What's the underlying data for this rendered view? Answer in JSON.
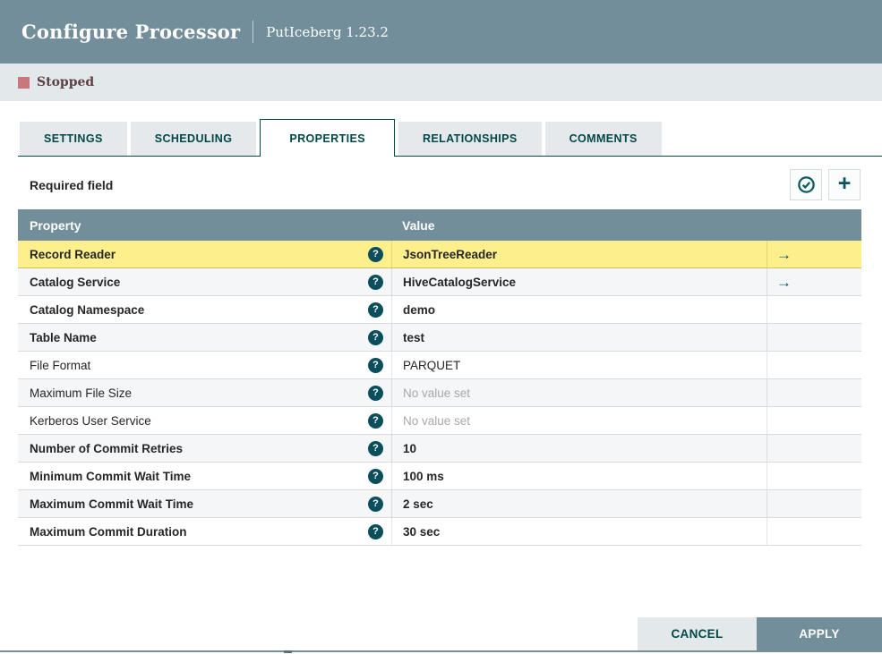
{
  "dialog": {
    "title": "Configure Processor",
    "subtitle": "PutIceberg 1.23.2"
  },
  "status": {
    "label": "Stopped"
  },
  "tabs": [
    {
      "label": "SETTINGS",
      "active": false
    },
    {
      "label": "SCHEDULING",
      "active": false
    },
    {
      "label": "PROPERTIES",
      "active": true
    },
    {
      "label": "RELATIONSHIPS",
      "active": false
    },
    {
      "label": "COMMENTS",
      "active": false
    }
  ],
  "toolbar": {
    "required_label": "Required field",
    "verify_icon": "check-circle-icon",
    "add_icon": "plus-icon"
  },
  "table": {
    "columns": [
      "Property",
      "Value"
    ],
    "rows": [
      {
        "property": "Record Reader",
        "value": "JsonTreeReader",
        "bold": true,
        "selected": true,
        "has_link": true,
        "empty": false
      },
      {
        "property": "Catalog Service",
        "value": "HiveCatalogService",
        "bold": true,
        "selected": false,
        "has_link": true,
        "empty": false
      },
      {
        "property": "Catalog Namespace",
        "value": "demo",
        "bold": true,
        "selected": false,
        "has_link": false,
        "empty": false
      },
      {
        "property": "Table Name",
        "value": "test",
        "bold": true,
        "selected": false,
        "has_link": false,
        "empty": false
      },
      {
        "property": "File Format",
        "value": "PARQUET",
        "bold": false,
        "selected": false,
        "has_link": false,
        "empty": false
      },
      {
        "property": "Maximum File Size",
        "value": "No value set",
        "bold": false,
        "selected": false,
        "has_link": false,
        "empty": true
      },
      {
        "property": "Kerberos User Service",
        "value": "No value set",
        "bold": false,
        "selected": false,
        "has_link": false,
        "empty": true
      },
      {
        "property": "Number of Commit Retries",
        "value": "10",
        "bold": true,
        "selected": false,
        "has_link": false,
        "empty": false
      },
      {
        "property": "Minimum Commit Wait Time",
        "value": "100 ms",
        "bold": true,
        "selected": false,
        "has_link": false,
        "empty": false
      },
      {
        "property": "Maximum Commit Wait Time",
        "value": "2 sec",
        "bold": true,
        "selected": false,
        "has_link": false,
        "empty": false
      },
      {
        "property": "Maximum Commit Duration",
        "value": "30 sec",
        "bold": true,
        "selected": false,
        "has_link": false,
        "empty": false
      }
    ]
  },
  "footer": {
    "cancel_label": "CANCEL",
    "apply_label": "APPLY"
  },
  "colors": {
    "header_bg": "#728e9b",
    "accent_teal": "#004849",
    "selected_row": "#fdf08c",
    "status_stopped": "#ca767d",
    "tab_inactive_bg": "#e5e9eb",
    "row_alt_bg": "#f4f6f7",
    "status_bar_bg": "#e3e8ea"
  }
}
